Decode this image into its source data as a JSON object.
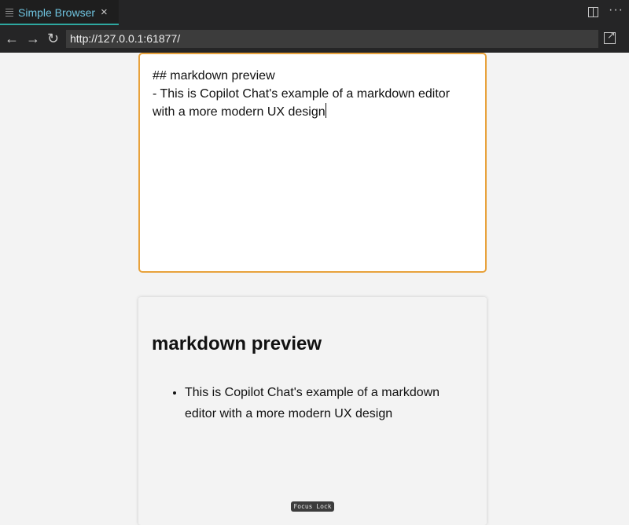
{
  "tab": {
    "title": "Simple Browser",
    "close_icon": "×"
  },
  "toolbar": {
    "split_icon": "split-editor",
    "more_icon": "···"
  },
  "nav": {
    "back": "←",
    "forward": "→",
    "reload": "↻"
  },
  "address": {
    "url": "http://127.0.0.1:61877/"
  },
  "editor": {
    "lines": [
      "## markdown preview",
      "- This is Copilot Chat's example of a markdown editor",
      "with a more modern UX design"
    ]
  },
  "preview": {
    "heading": "markdown preview",
    "items": [
      "This is Copilot Chat's example of a markdown editor with a more modern UX design"
    ]
  },
  "badge": {
    "text": "Focus Lock"
  },
  "colors": {
    "accent": "#2ea8a0",
    "editor_border": "#e8a23c",
    "tab_title": "#6fc3df"
  }
}
